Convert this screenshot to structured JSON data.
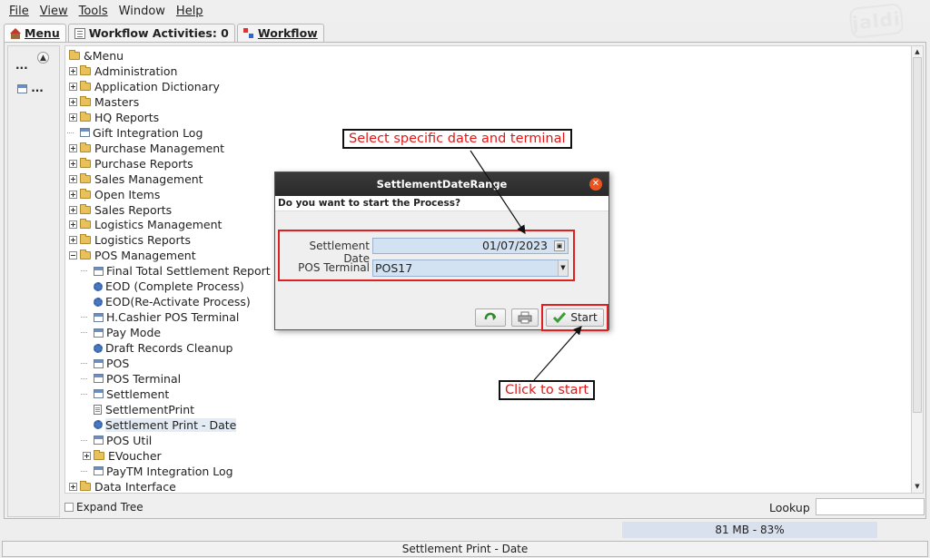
{
  "menubar": {
    "items": [
      "File",
      "View",
      "Tools",
      "Window",
      "Help"
    ],
    "logo": "jaldi"
  },
  "tabs": [
    {
      "label": "Menu",
      "icon": "home-icon"
    },
    {
      "label": "Workflow Activities: 0",
      "icon": "list-icon"
    },
    {
      "label": "Workflow",
      "icon": "workflow-icon"
    }
  ],
  "left_panel": {
    "dots_top": "...",
    "dots_bottom": "..."
  },
  "tree": {
    "root": "&Menu",
    "items": [
      {
        "label": "Administration",
        "type": "folder",
        "level": 1
      },
      {
        "label": "Application Dictionary",
        "type": "folder",
        "level": 1
      },
      {
        "label": "Masters",
        "type": "folder",
        "level": 1
      },
      {
        "label": "HQ Reports",
        "type": "folder",
        "level": 1
      },
      {
        "label": "Gift Integration Log",
        "type": "window",
        "level": 1
      },
      {
        "label": "Purchase Management",
        "type": "folder",
        "level": 1
      },
      {
        "label": "Purchase Reports",
        "type": "folder",
        "level": 1
      },
      {
        "label": "Sales Management",
        "type": "folder",
        "level": 1
      },
      {
        "label": "Open Items",
        "type": "folder",
        "level": 1
      },
      {
        "label": "Sales Reports",
        "type": "folder",
        "level": 1
      },
      {
        "label": "Logistics Management",
        "type": "folder",
        "level": 1
      },
      {
        "label": "Logistics Reports",
        "type": "folder",
        "level": 1
      },
      {
        "label": "POS Management",
        "type": "folder-open",
        "level": 1
      },
      {
        "label": "Final Total Settlement Report",
        "type": "window",
        "level": 2
      },
      {
        "label": "EOD (Complete Process)",
        "type": "process",
        "level": 2
      },
      {
        "label": "EOD(Re-Activate Process)",
        "type": "process",
        "level": 2
      },
      {
        "label": "H.Cashier POS Terminal",
        "type": "window",
        "level": 2
      },
      {
        "label": "Pay Mode",
        "type": "window",
        "level": 2
      },
      {
        "label": "Draft Records Cleanup",
        "type": "process",
        "level": 2
      },
      {
        "label": "POS",
        "type": "window",
        "level": 2
      },
      {
        "label": "POS Terminal",
        "type": "window",
        "level": 2
      },
      {
        "label": "Settlement",
        "type": "window",
        "level": 2
      },
      {
        "label": "SettlementPrint",
        "type": "report",
        "level": 2
      },
      {
        "label": "Settlement Print - Date",
        "type": "process",
        "level": 2,
        "selected": true
      },
      {
        "label": "POS Util",
        "type": "window",
        "level": 2
      },
      {
        "label": "EVoucher",
        "type": "folder",
        "level": 2
      },
      {
        "label": "PayTM Integration Log",
        "type": "window",
        "level": 2
      },
      {
        "label": "Data Interface",
        "type": "folder",
        "level": 1
      }
    ]
  },
  "bottom": {
    "expand_tree": "Expand Tree",
    "lookup_label": "Lookup",
    "lookup_value": ""
  },
  "memory": "81 MB - 83%",
  "status": "Settlement Print - Date",
  "dialog": {
    "title": "SettlementDateRange",
    "question": "Do you want to start the Process?",
    "date_label": "Settlement Date",
    "date_value": "01/07/2023",
    "terminal_label": "POS Terminal",
    "terminal_value": "POS17",
    "start_label": "Start"
  },
  "callouts": {
    "top": "Select specific date and terminal",
    "bottom": "Click to start"
  },
  "colors": {
    "accent_red": "#e01818",
    "selection": "#e3ebf5",
    "field_bg": "#d2e2f3",
    "close_button": "#e95420"
  }
}
